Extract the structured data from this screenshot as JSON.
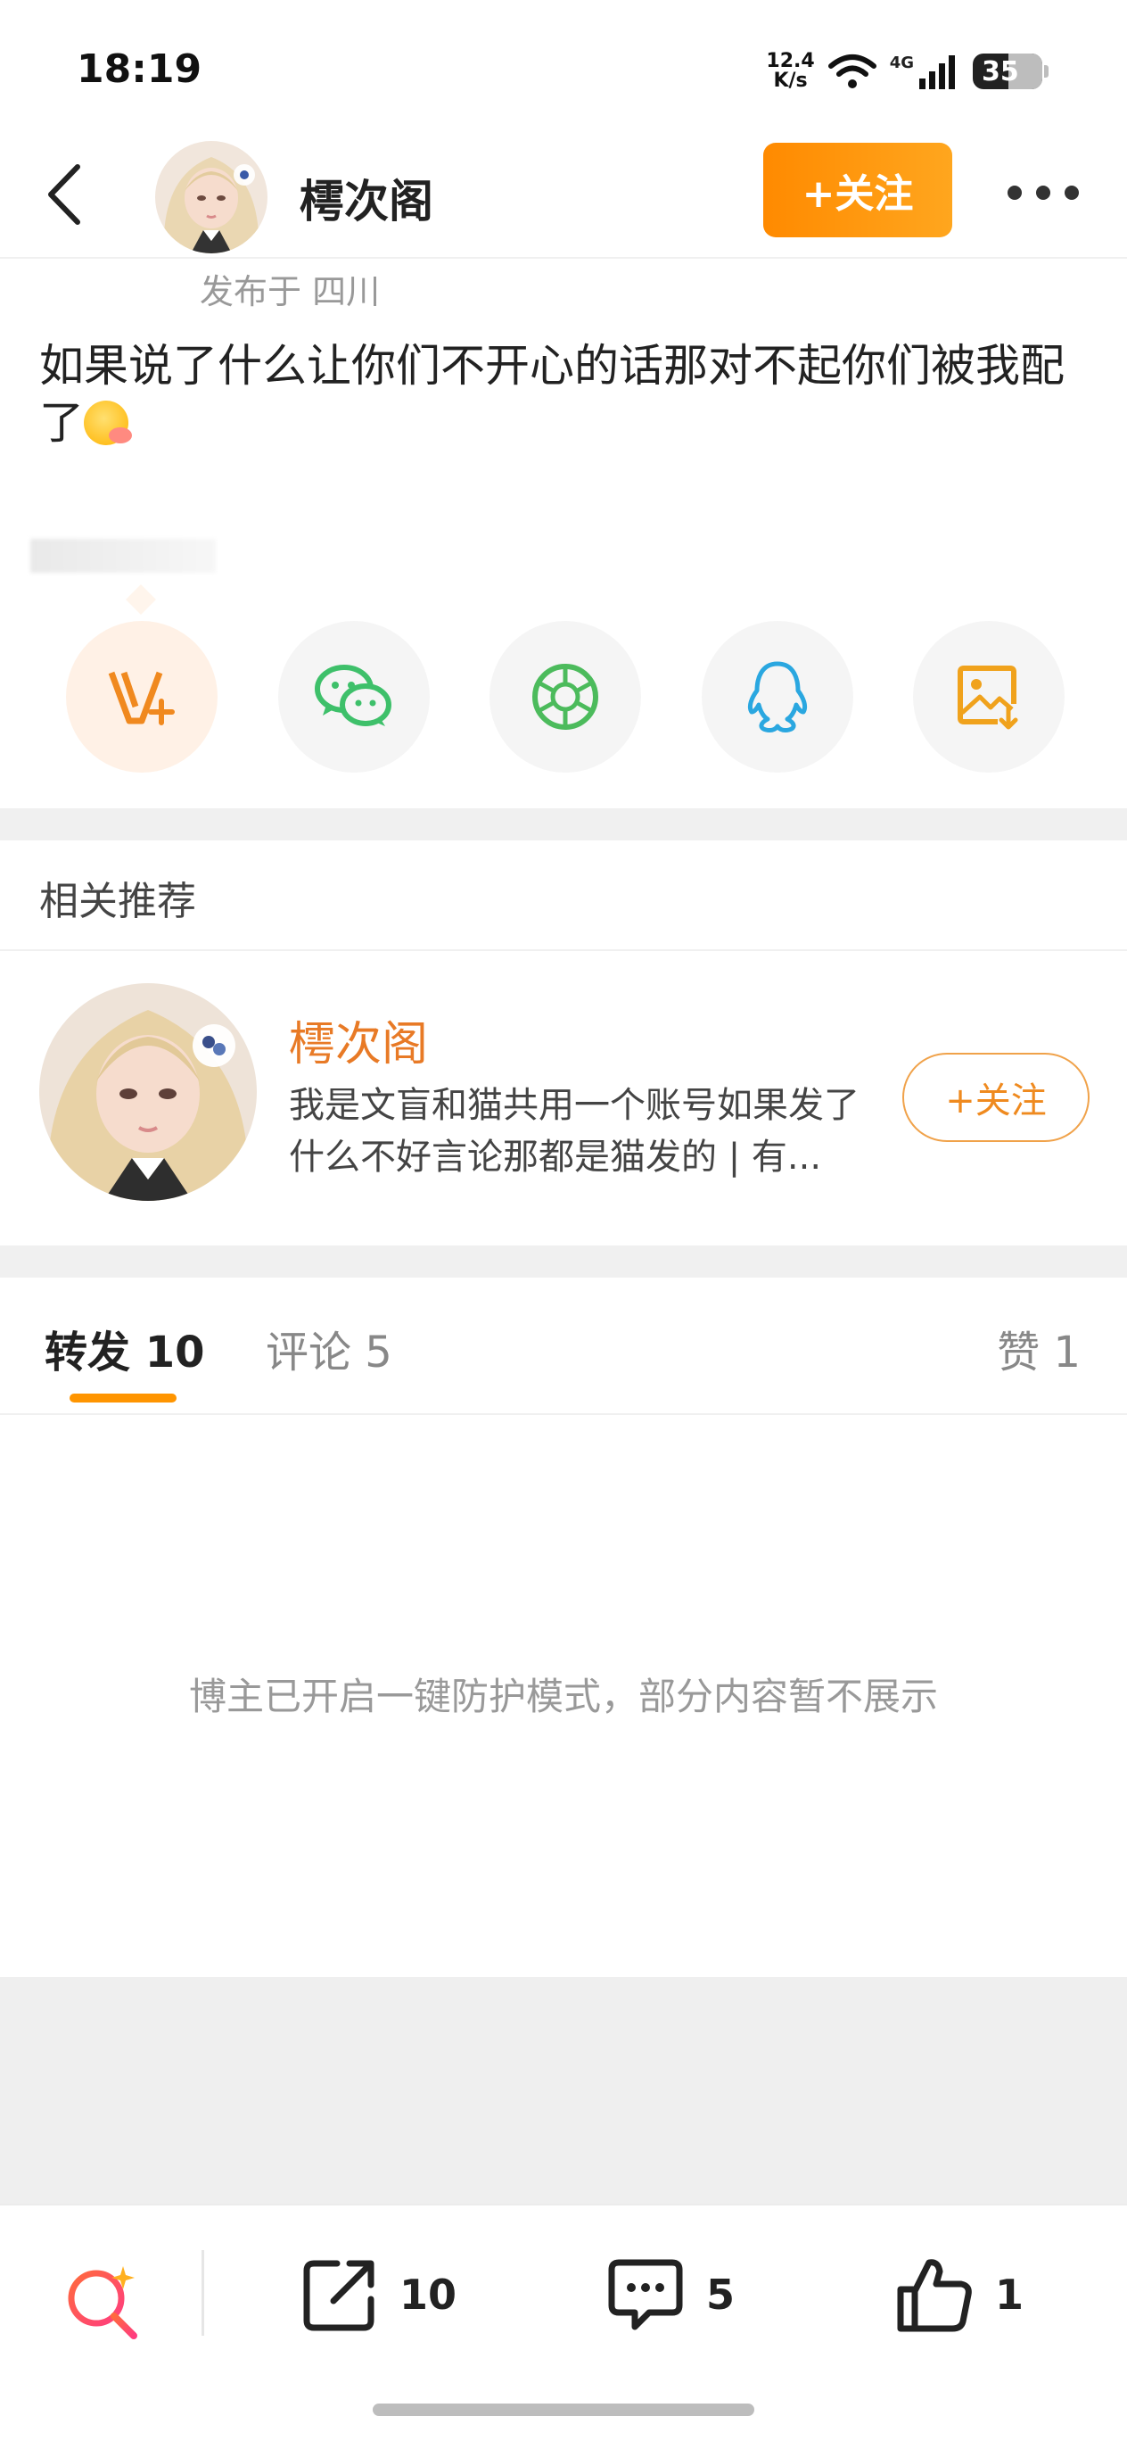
{
  "status_bar": {
    "time": "18:19",
    "net_speed_value": "12.4",
    "net_speed_unit": "K/s",
    "network": "4G",
    "battery": "35"
  },
  "header": {
    "username": "樗次阁",
    "follow_label": "+关注"
  },
  "post": {
    "location": "发布于 四川",
    "text": "如果说了什么让你们不开心的话那对不起你们被我配了"
  },
  "share_options": [
    {
      "name": "vplus-share",
      "icon": "v-plus-icon",
      "color": "#f0891f"
    },
    {
      "name": "wechat-share",
      "icon": "wechat-icon",
      "color": "#3ec06a"
    },
    {
      "name": "moments-share",
      "icon": "moments-icon",
      "color": "#4cbb5c"
    },
    {
      "name": "qq-share",
      "icon": "qq-icon",
      "color": "#2aa7e0"
    },
    {
      "name": "save-image",
      "icon": "save-image-icon",
      "color": "#f0a21c"
    }
  ],
  "recommend": {
    "title": "相关推荐",
    "user": {
      "name": "樗次阁",
      "description": "我是文盲和猫共用一个账号如果发了什么不好言论那都是猫发的 | 有...",
      "follow_label": "+关注"
    }
  },
  "tabs": {
    "repost": "转发 10",
    "comment": "评论 5",
    "like": "赞 1"
  },
  "notice": "博主已开启一键防护模式，部分内容暂不展示",
  "bottom_bar": {
    "repost_count": "10",
    "comment_count": "5",
    "like_count": "1"
  },
  "colors": {
    "accent": "#ff9500",
    "name_orange": "#e87a26"
  }
}
